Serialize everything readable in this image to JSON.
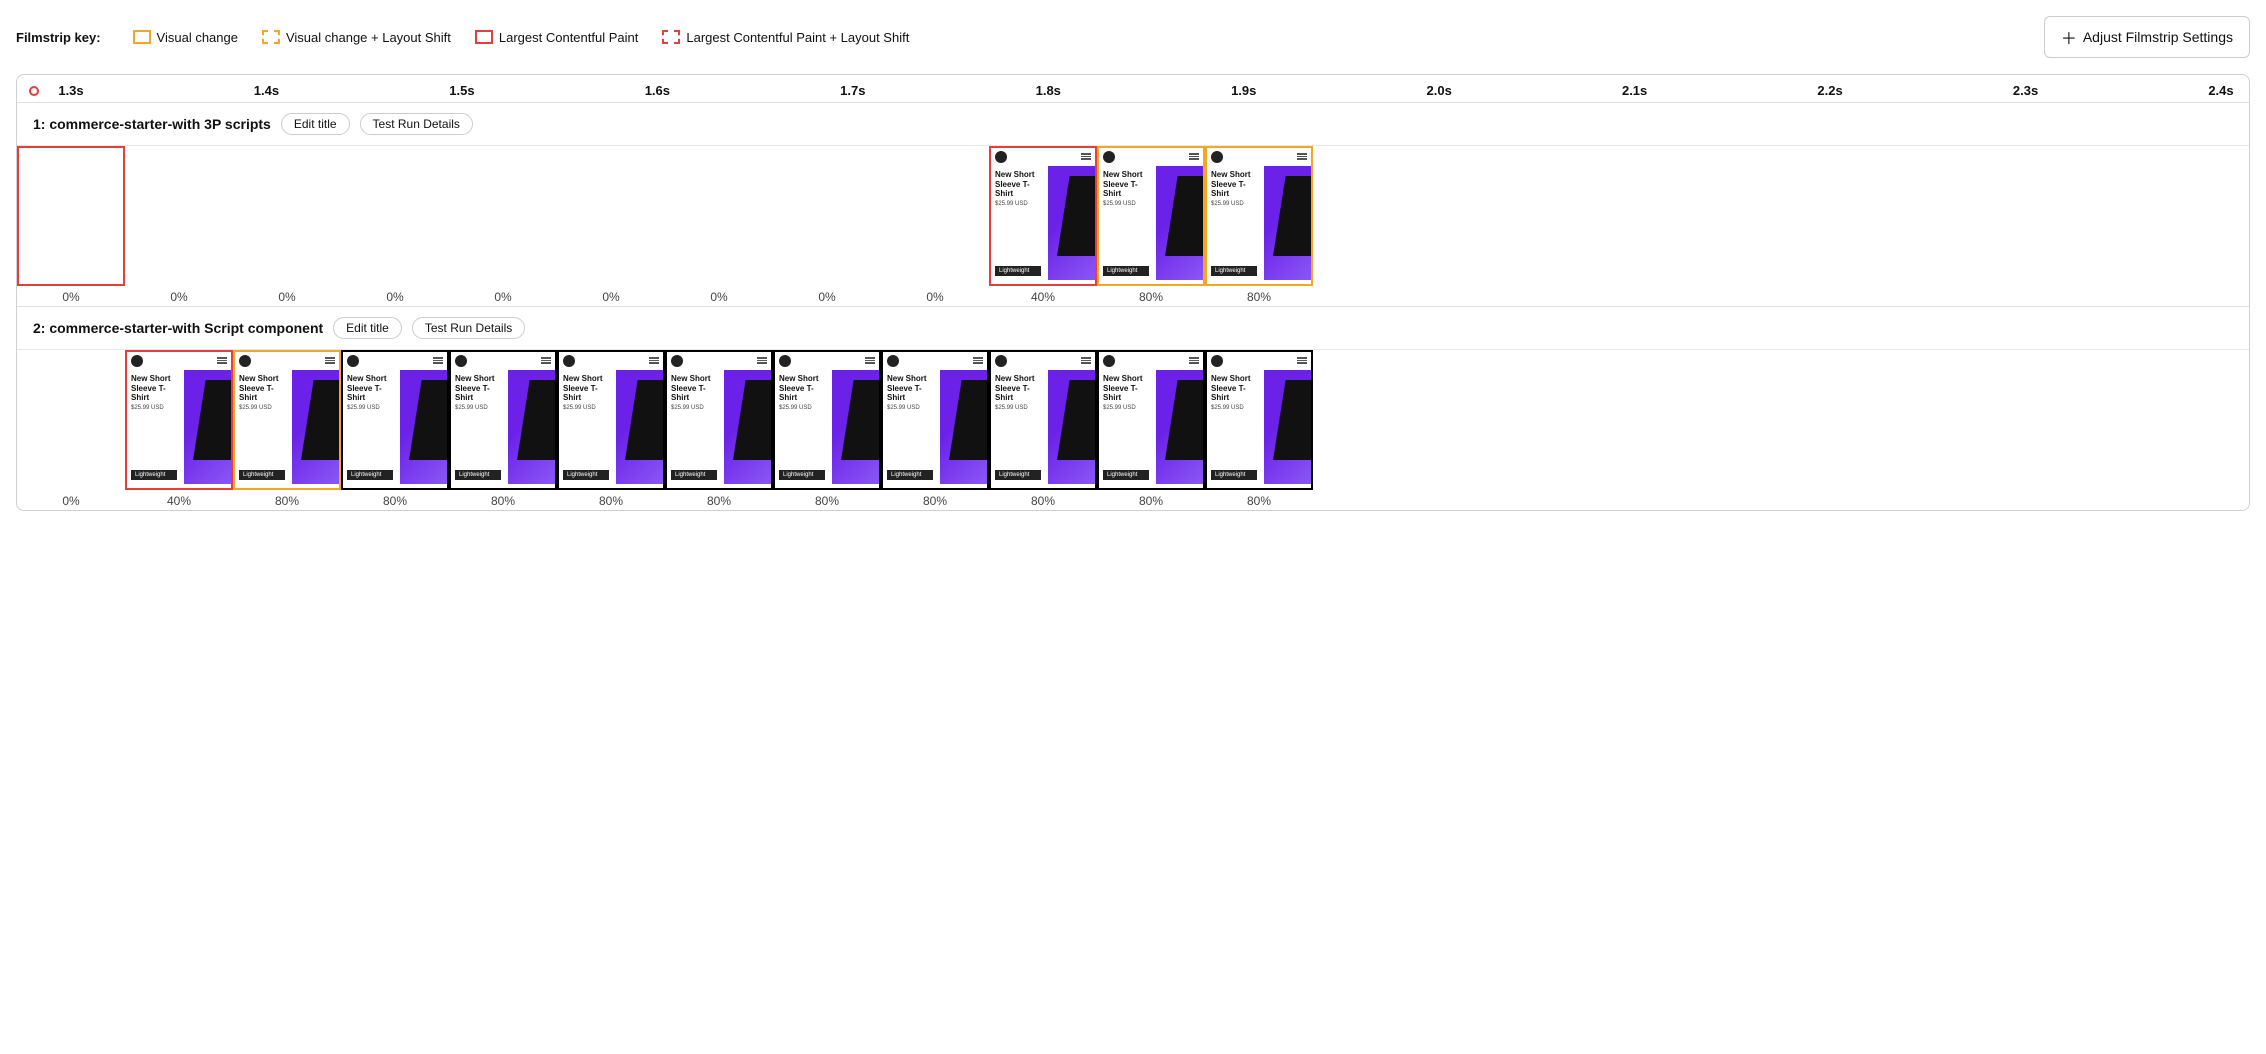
{
  "legend": {
    "label": "Filmstrip key:",
    "items": [
      {
        "id": "visual-change",
        "text": "Visual change",
        "style": "yellow-solid"
      },
      {
        "id": "visual-change-layout-shift",
        "text": "Visual change + Layout Shift",
        "style": "yellow-dashed"
      },
      {
        "id": "lcp",
        "text": "Largest Contentful Paint",
        "style": "red-solid"
      },
      {
        "id": "lcp-layout-shift",
        "text": "Largest Contentful Paint + Layout Shift",
        "style": "red-dashed"
      }
    ],
    "adjust_button": "Adjust Filmstrip Settings"
  },
  "timeline": {
    "ticks": [
      "1.3s",
      "1.4s",
      "1.5s",
      "1.6s",
      "1.7s",
      "1.8s",
      "1.9s",
      "2.0s",
      "2.1s",
      "2.2s",
      "2.3s",
      "2.4s"
    ]
  },
  "sections": [
    {
      "id": "section-1",
      "title": "1: commerce-starter-with 3P scripts",
      "edit_title_label": "Edit title",
      "test_run_label": "Test Run Details",
      "frames": [
        {
          "border": "red-solid",
          "empty": true,
          "percent": "0%"
        },
        {
          "border": "none",
          "empty": true,
          "percent": "0%"
        },
        {
          "border": "none",
          "empty": true,
          "percent": "0%"
        },
        {
          "border": "none",
          "empty": true,
          "percent": "0%"
        },
        {
          "border": "none",
          "empty": true,
          "percent": "0%"
        },
        {
          "border": "none",
          "empty": true,
          "percent": "0%"
        },
        {
          "border": "none",
          "empty": true,
          "percent": "0%"
        },
        {
          "border": "none",
          "empty": true,
          "percent": "0%"
        },
        {
          "border": "none",
          "empty": true,
          "percent": "0%"
        },
        {
          "border": "red-solid",
          "empty": false,
          "percent": "40%"
        },
        {
          "border": "yellow-solid",
          "empty": false,
          "percent": "80%"
        },
        {
          "border": "yellow-solid",
          "empty": false,
          "percent": "80%"
        }
      ]
    },
    {
      "id": "section-2",
      "title": "2: commerce-starter-with Script component",
      "edit_title_label": "Edit title",
      "test_run_label": "Test Run Details",
      "frames": [
        {
          "border": "none",
          "empty": true,
          "percent": "0%"
        },
        {
          "border": "red-solid",
          "empty": false,
          "percent": "40%"
        },
        {
          "border": "yellow-solid",
          "empty": false,
          "percent": "80%"
        },
        {
          "border": "none",
          "empty": false,
          "percent": "80%"
        },
        {
          "border": "none",
          "empty": false,
          "percent": "80%"
        },
        {
          "border": "none",
          "empty": false,
          "percent": "80%"
        },
        {
          "border": "none",
          "empty": false,
          "percent": "80%"
        },
        {
          "border": "none",
          "empty": false,
          "percent": "80%"
        },
        {
          "border": "none",
          "empty": false,
          "percent": "80%"
        },
        {
          "border": "none",
          "empty": false,
          "percent": "80%"
        },
        {
          "border": "none",
          "empty": false,
          "percent": "80%"
        },
        {
          "border": "none",
          "empty": false,
          "percent": "80%"
        }
      ]
    }
  ]
}
